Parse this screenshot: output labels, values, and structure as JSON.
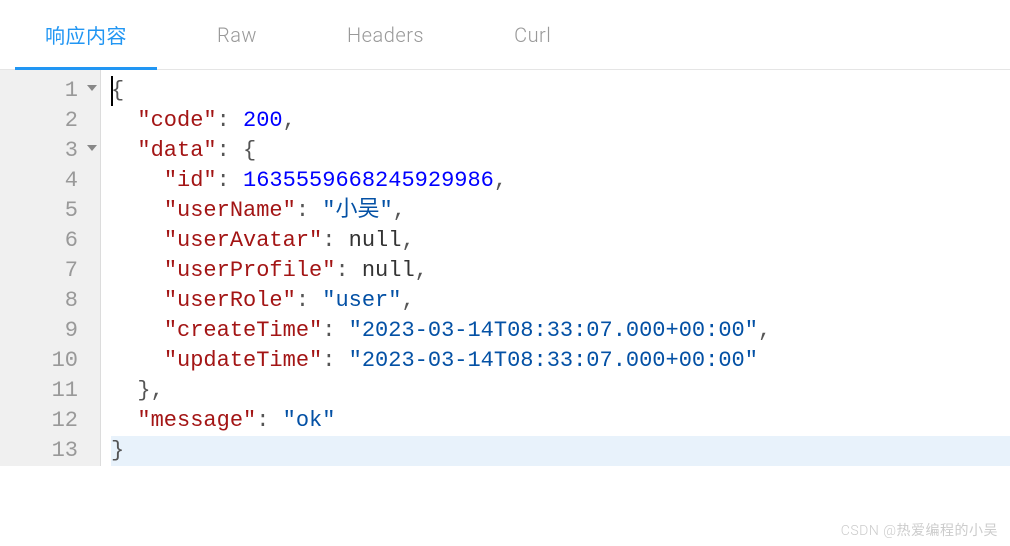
{
  "tabs": [
    {
      "label": "响应内容",
      "active": true
    },
    {
      "label": "Raw",
      "active": false
    },
    {
      "label": "Headers",
      "active": false
    },
    {
      "label": "Curl",
      "active": false
    }
  ],
  "lines": [
    {
      "num": "1",
      "fold": true,
      "tokens": [
        {
          "t": "{",
          "c": "s-punc"
        }
      ]
    },
    {
      "num": "2",
      "fold": false,
      "tokens": [
        {
          "t": "  ",
          "c": ""
        },
        {
          "t": "\"code\"",
          "c": "s-key"
        },
        {
          "t": ": ",
          "c": "s-colon"
        },
        {
          "t": "200",
          "c": "s-num"
        },
        {
          "t": ",",
          "c": "s-punc"
        }
      ]
    },
    {
      "num": "3",
      "fold": true,
      "tokens": [
        {
          "t": "  ",
          "c": ""
        },
        {
          "t": "\"data\"",
          "c": "s-key"
        },
        {
          "t": ": ",
          "c": "s-colon"
        },
        {
          "t": "{",
          "c": "s-punc"
        }
      ]
    },
    {
      "num": "4",
      "fold": false,
      "tokens": [
        {
          "t": "    ",
          "c": ""
        },
        {
          "t": "\"id\"",
          "c": "s-key"
        },
        {
          "t": ": ",
          "c": "s-colon"
        },
        {
          "t": "1635559668245929986",
          "c": "s-num"
        },
        {
          "t": ",",
          "c": "s-punc"
        }
      ]
    },
    {
      "num": "5",
      "fold": false,
      "tokens": [
        {
          "t": "    ",
          "c": ""
        },
        {
          "t": "\"userName\"",
          "c": "s-key"
        },
        {
          "t": ": ",
          "c": "s-colon"
        },
        {
          "t": "\"小吴\"",
          "c": "s-str"
        },
        {
          "t": ",",
          "c": "s-punc"
        }
      ]
    },
    {
      "num": "6",
      "fold": false,
      "tokens": [
        {
          "t": "    ",
          "c": ""
        },
        {
          "t": "\"userAvatar\"",
          "c": "s-key"
        },
        {
          "t": ": ",
          "c": "s-colon"
        },
        {
          "t": "null",
          "c": "s-null"
        },
        {
          "t": ",",
          "c": "s-punc"
        }
      ]
    },
    {
      "num": "7",
      "fold": false,
      "tokens": [
        {
          "t": "    ",
          "c": ""
        },
        {
          "t": "\"userProfile\"",
          "c": "s-key"
        },
        {
          "t": ": ",
          "c": "s-colon"
        },
        {
          "t": "null",
          "c": "s-null"
        },
        {
          "t": ",",
          "c": "s-punc"
        }
      ]
    },
    {
      "num": "8",
      "fold": false,
      "tokens": [
        {
          "t": "    ",
          "c": ""
        },
        {
          "t": "\"userRole\"",
          "c": "s-key"
        },
        {
          "t": ": ",
          "c": "s-colon"
        },
        {
          "t": "\"user\"",
          "c": "s-str"
        },
        {
          "t": ",",
          "c": "s-punc"
        }
      ]
    },
    {
      "num": "9",
      "fold": false,
      "tokens": [
        {
          "t": "    ",
          "c": ""
        },
        {
          "t": "\"createTime\"",
          "c": "s-key"
        },
        {
          "t": ": ",
          "c": "s-colon"
        },
        {
          "t": "\"2023-03-14T08:33:07.000+00:00\"",
          "c": "s-str"
        },
        {
          "t": ",",
          "c": "s-punc"
        }
      ]
    },
    {
      "num": "10",
      "fold": false,
      "tokens": [
        {
          "t": "    ",
          "c": ""
        },
        {
          "t": "\"updateTime\"",
          "c": "s-key"
        },
        {
          "t": ": ",
          "c": "s-colon"
        },
        {
          "t": "\"2023-03-14T08:33:07.000+00:00\"",
          "c": "s-str"
        }
      ]
    },
    {
      "num": "11",
      "fold": false,
      "tokens": [
        {
          "t": "  ",
          "c": ""
        },
        {
          "t": "}",
          "c": "s-punc"
        },
        {
          "t": ",",
          "c": "s-punc"
        }
      ]
    },
    {
      "num": "12",
      "fold": false,
      "tokens": [
        {
          "t": "  ",
          "c": ""
        },
        {
          "t": "\"message\"",
          "c": "s-key"
        },
        {
          "t": ": ",
          "c": "s-colon"
        },
        {
          "t": "\"ok\"",
          "c": "s-str"
        }
      ]
    },
    {
      "num": "13",
      "fold": false,
      "hl": true,
      "tokens": [
        {
          "t": "}",
          "c": "s-punc"
        }
      ]
    }
  ],
  "watermark": "CSDN @热爱编程的小吴"
}
